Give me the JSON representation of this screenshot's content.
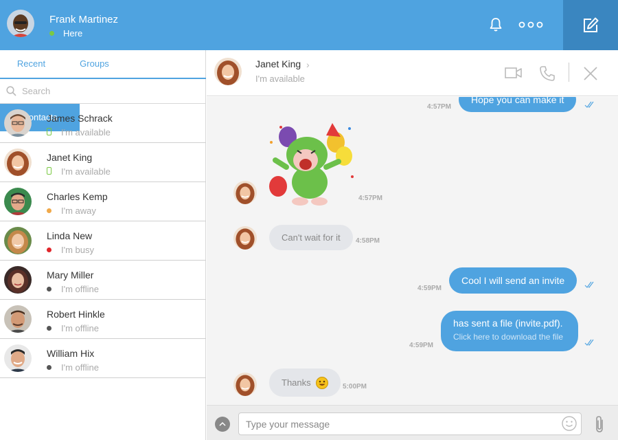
{
  "user": {
    "name": "Frank Martinez",
    "status": "Here",
    "status_color": "#7ac943"
  },
  "colors": {
    "accent": "#4fa3e0",
    "accent_dark": "#3a86c0",
    "available": "#7ac943",
    "away": "#f0a94a",
    "busy": "#e0262b",
    "offline": "#555555"
  },
  "header_icons": [
    "bell-icon",
    "more-icon",
    "compose-icon"
  ],
  "tabs": {
    "recent": "Recent",
    "contacts": "Contacts",
    "groups": "Groups",
    "active": "Contacts"
  },
  "search": {
    "placeholder": "Search"
  },
  "contacts": [
    {
      "name": "James Schrack",
      "status": "I'm available",
      "indicator": "mobile"
    },
    {
      "name": "Janet King",
      "status": "I'm available",
      "indicator": "mobile"
    },
    {
      "name": "Charles Kemp",
      "status": "I'm away",
      "indicator": "away"
    },
    {
      "name": "Linda New",
      "status": "I'm busy",
      "indicator": "busy"
    },
    {
      "name": "Mary Miller",
      "status": "I'm offline",
      "indicator": "offline"
    },
    {
      "name": "Robert Hinkle",
      "status": "I'm offline",
      "indicator": "offline"
    },
    {
      "name": "William Hix",
      "status": "I'm offline",
      "indicator": "offline"
    }
  ],
  "chat": {
    "name": "Janet King",
    "status": "I'm available",
    "chevron": "›",
    "messages": {
      "m1": {
        "text": "Hope you can make it",
        "time": "4:57PM"
      },
      "m2": {
        "sticker": "party-monkey",
        "time": "4:57PM"
      },
      "m3": {
        "text": "Can't wait for it",
        "time": "4:58PM"
      },
      "m4": {
        "text": "Cool I will send an invite",
        "time": "4:59PM"
      },
      "m5": {
        "text": "has sent a file (invite.pdf).",
        "sub": "Click here to download the file",
        "time": "4:59PM"
      },
      "m6": {
        "text": "Thanks",
        "time": "5:00PM"
      }
    }
  },
  "composer": {
    "placeholder": "Type your message"
  }
}
